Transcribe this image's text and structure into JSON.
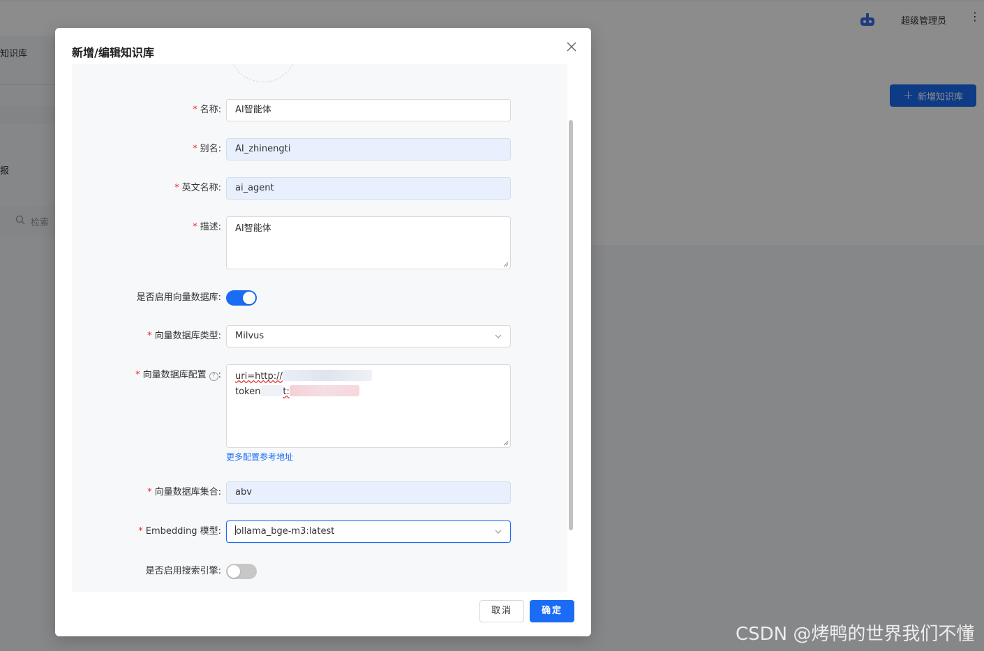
{
  "header": {
    "username": "超级管理员"
  },
  "background": {
    "tab_label": "知识库",
    "side_char": "报",
    "search_label": "检索",
    "add_button_label": "新增知识库"
  },
  "dialog": {
    "title": "新增/编辑知识库",
    "fields": {
      "name": {
        "label": "名称:",
        "value": "AI智能体"
      },
      "alias": {
        "label": "别名:",
        "value": "AI_zhinengti"
      },
      "english_name": {
        "label": "英文名称:",
        "value": "ai_agent"
      },
      "description": {
        "label": "描述:",
        "value": "AI智能体"
      },
      "enable_vector_db": {
        "label": "是否启用向量数据库:",
        "on": true
      },
      "vector_db_type": {
        "label": "向量数据库类型:",
        "value": "Milvus"
      },
      "vector_db_config": {
        "label": "向量数据库配置",
        "help_glyph": "?",
        "line1": "uri=http://",
        "line2_a": "token",
        "line2_b": "t:",
        "more_link": "更多配置参考地址"
      },
      "vector_db_collection": {
        "label": "向量数据库集合:",
        "value": "abv"
      },
      "embedding_model": {
        "label": "Embedding 模型:",
        "value": "ollama_bge-m3:latest"
      },
      "enable_search_engine": {
        "label": "是否启用搜索引擎:",
        "on": false
      }
    },
    "required_mark": "*",
    "cancel_label": "取消",
    "ok_label": "确定"
  },
  "watermark": "CSDN @烤鸭的世界我们不懂",
  "colors": {
    "primary": "#1a6cf5",
    "required": "#f5222d",
    "mask": "rgba(0,0,0,0.45)"
  },
  "icons": [
    "robot-icon",
    "more-vertical-icon",
    "search-icon",
    "plus-icon",
    "close-icon",
    "chevron-down-icon",
    "help-icon"
  ]
}
